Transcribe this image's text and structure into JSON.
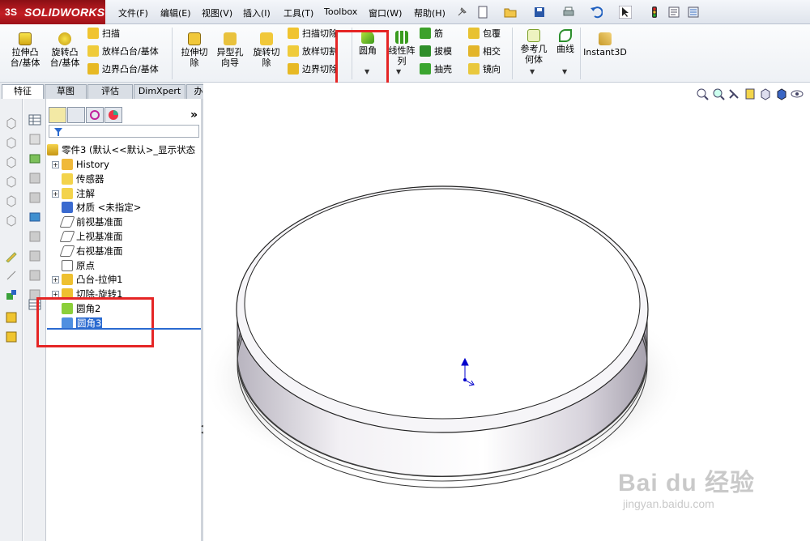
{
  "app": {
    "brand": "SOLIDWORKS",
    "brand_mark": "3S"
  },
  "menu": [
    "文件(F)",
    "编辑(E)",
    "视图(V)",
    "插入(I)",
    "工具(T)",
    "Toolbox",
    "窗口(W)",
    "帮助(H)"
  ],
  "ribbon": {
    "extrude_boss": "拉伸凸\n台/基体",
    "revolve_boss": "旋转凸\n台/基体",
    "sweep": "扫描",
    "loft": "放样凸台/基体",
    "boundary_boss": "边界凸台/基体",
    "extrude_cut": "拉伸切\n除",
    "hole_wizard": "异型孔\n向导",
    "revolve_cut": "旋转切\n除",
    "sweep_cut": "扫描切除",
    "loft_cut": "放样切割",
    "boundary_cut": "边界切除",
    "fillet": "圆角",
    "linear_pattern": "线性阵\n列",
    "rib": "筋",
    "draft": "拔模",
    "shell": "抽壳",
    "wrap": "包覆",
    "intersect": "相交",
    "mirror": "镜向",
    "ref_geometry": "参考几\n何体",
    "curves": "曲线",
    "instant3d": "Instant3D"
  },
  "tabs": [
    "特征",
    "草图",
    "评估",
    "DimXpert",
    "办公室产品"
  ],
  "tree": {
    "root": "零件3 (默认<<默认>_显示状态",
    "items": [
      {
        "label": "History",
        "expand": true,
        "icon": "history-icon"
      },
      {
        "label": "传感器",
        "expand": false,
        "icon": "sensor-icon"
      },
      {
        "label": "注解",
        "expand": true,
        "icon": "annotation-icon"
      },
      {
        "label": "材质 <未指定>",
        "expand": false,
        "icon": "material-icon"
      },
      {
        "label": "前视基准面",
        "expand": false,
        "icon": "plane-icon"
      },
      {
        "label": "上视基准面",
        "expand": false,
        "icon": "plane-icon"
      },
      {
        "label": "右视基准面",
        "expand": false,
        "icon": "plane-icon"
      },
      {
        "label": "原点",
        "expand": false,
        "icon": "origin-icon"
      },
      {
        "label": "凸台-拉伸1",
        "expand": true,
        "icon": "extrude-icon"
      },
      {
        "label": "切除-旋转1",
        "expand": true,
        "icon": "cut-revolve-icon"
      },
      {
        "label": "圆角2",
        "expand": false,
        "icon": "fillet-icon"
      },
      {
        "label": "圆角3",
        "expand": false,
        "icon": "fillet-icon",
        "selected": true
      }
    ]
  },
  "watermark": {
    "brand": "Bai du 经验",
    "url": "jingyan.baidu.com"
  },
  "colors": {
    "highlight_box": "#e52525",
    "selection": "#2a6ad0"
  }
}
